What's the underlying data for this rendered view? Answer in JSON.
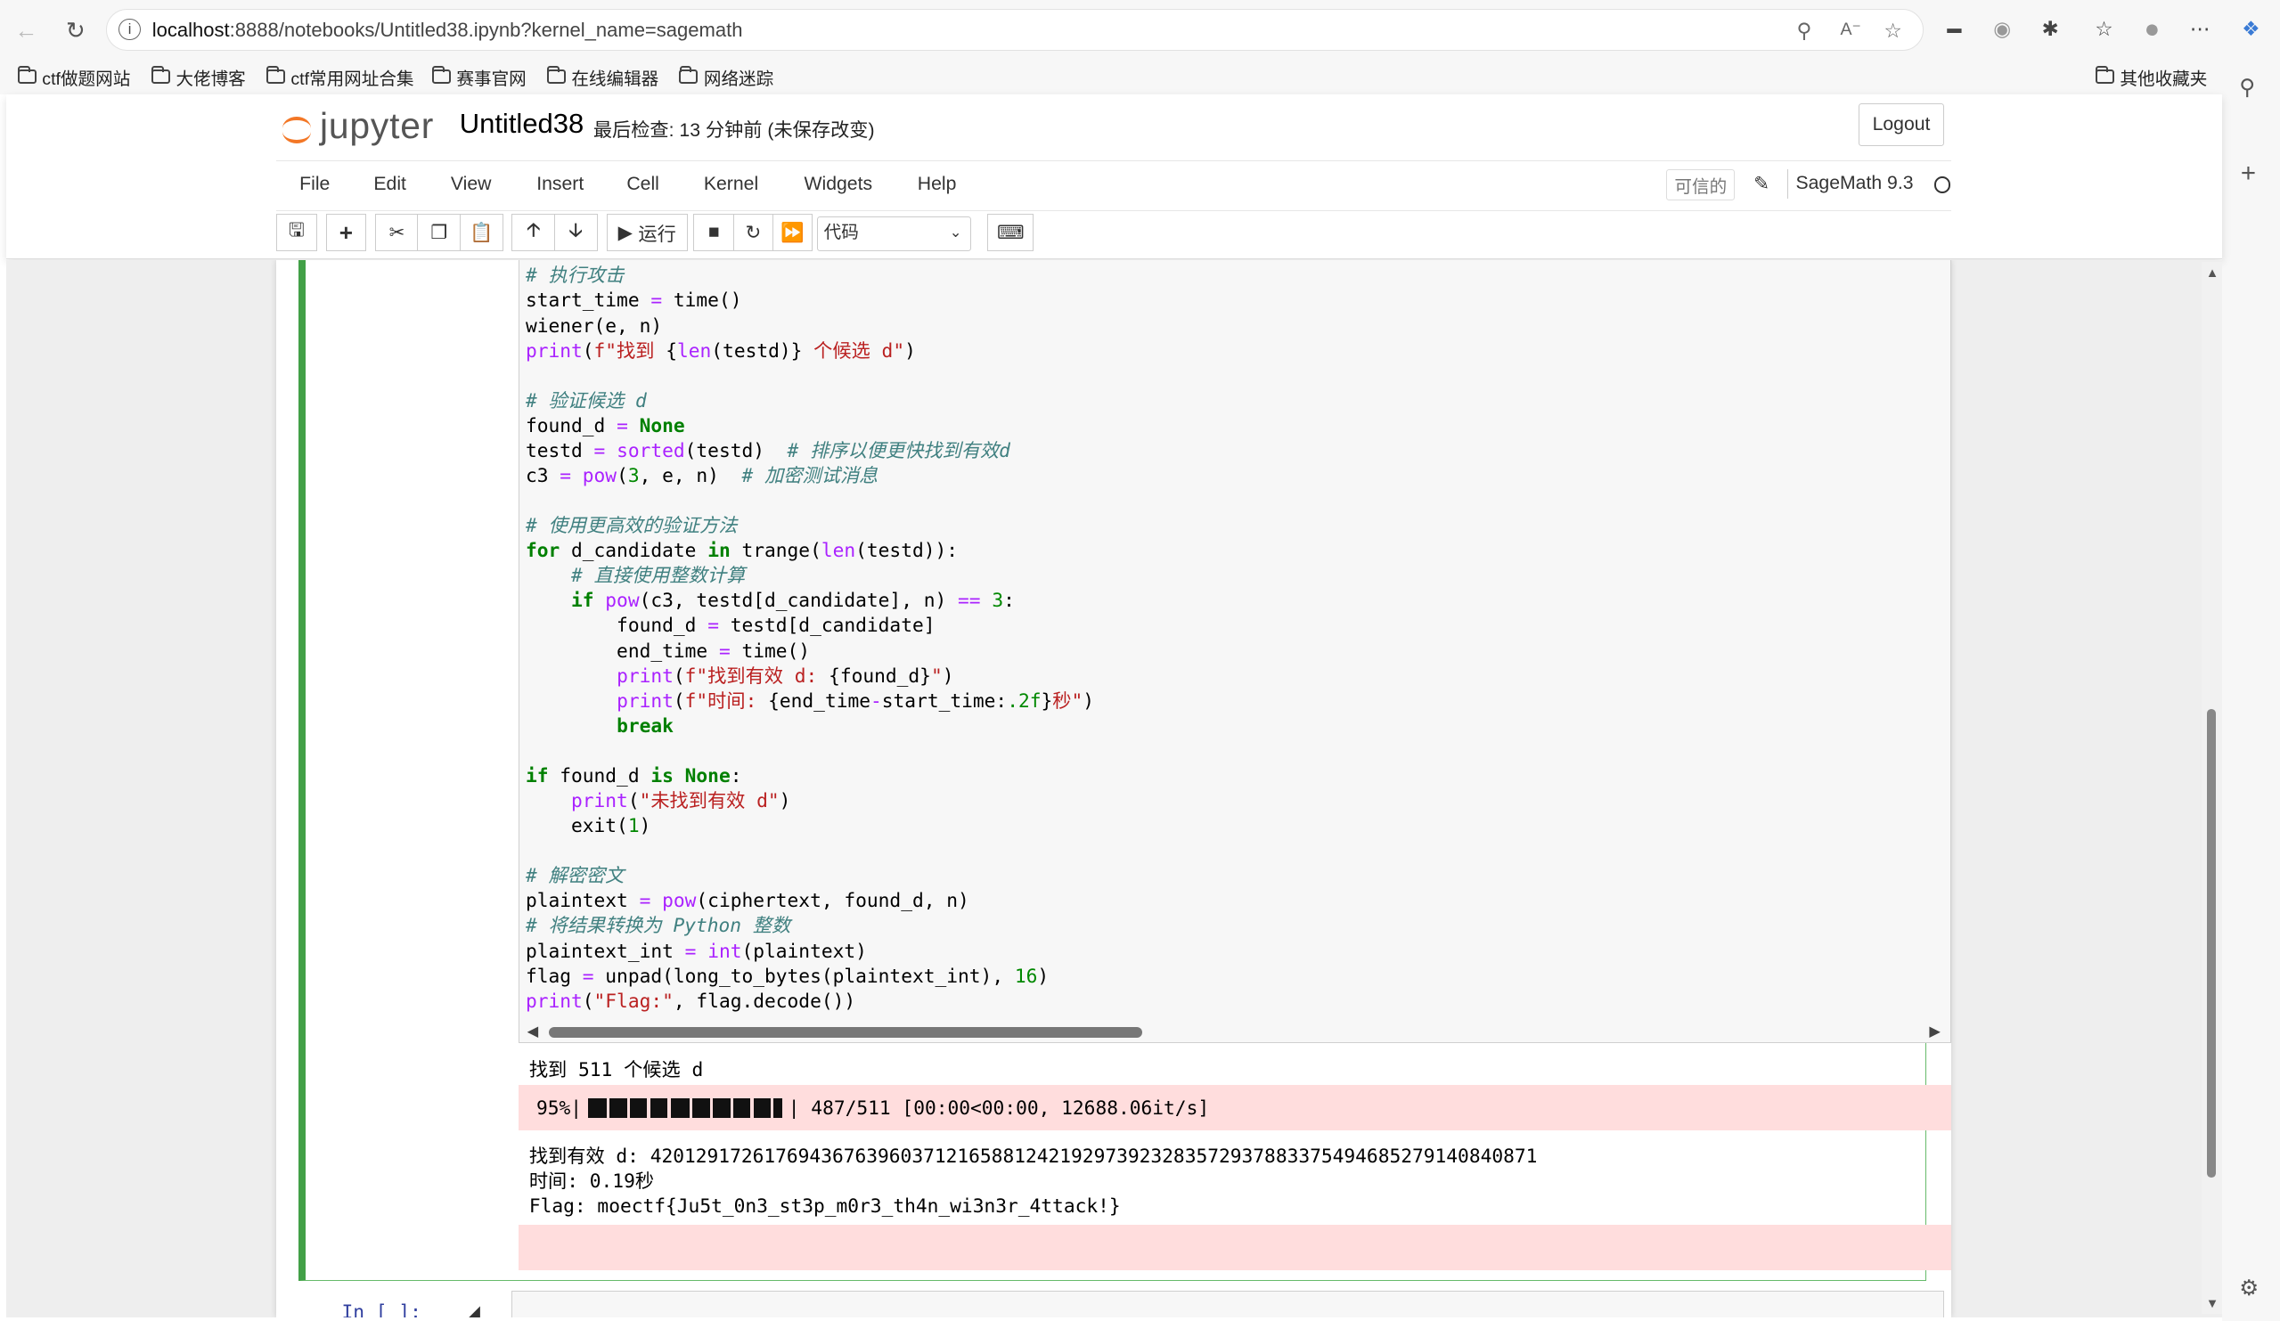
{
  "browser": {
    "url_host": "localhost",
    "url_path": ":8888/notebooks/Untitled38.ipynb?kernel_name=sagemath",
    "bookmarks": [
      "ctf做题网站",
      "大佬博客",
      "ctf常用网址合集",
      "赛事官网",
      "在线编辑器",
      "网络迷踪"
    ],
    "other_bookmarks": "其他收藏夹"
  },
  "header": {
    "logo_text": "jupyter",
    "notebook_title": "Untitled38",
    "save_status": "最后检查: 13 分钟前  (未保存改变)",
    "logout_label": "Logout"
  },
  "menubar": {
    "items": [
      "File",
      "Edit",
      "View",
      "Insert",
      "Cell",
      "Kernel",
      "Widgets",
      "Help"
    ],
    "trusted_label": "可信的",
    "kernel_name": "SageMath 9.3"
  },
  "toolbar": {
    "run_label": "运行",
    "cell_type": "代码"
  },
  "cell": {
    "output_line1": "找到 511 个候选 d",
    "progress_percent": "95%",
    "progress_fraction": 0.95,
    "progress_stats": " 487/511 [00:00<00:00, 12688.06it/s]",
    "output_line2": "找到有效 d: 420129172617694367639603712165881242192973923283572937883375494685279140840871",
    "output_line3": "时间: 0.19秒",
    "output_line4": "Flag: moectf{Ju5t_0n3_st3p_m0r3_th4n_wi3n3r_4ttack!}"
  },
  "next_cell": {
    "prompt": "In  [  ]:"
  }
}
